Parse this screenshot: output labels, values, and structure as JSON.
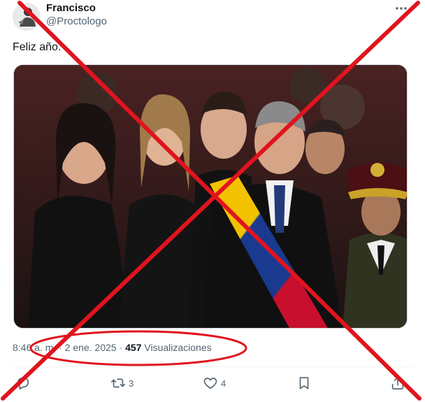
{
  "author": {
    "name": "Francisco",
    "handle": "@Proctologo"
  },
  "tweet": {
    "text": "Feliz año."
  },
  "meta": {
    "time": "8:46 a. m.",
    "sep1": " · ",
    "date": "2 ene. 2025",
    "sep2": " · ",
    "views": "457",
    "views_label": " Visualizaciones"
  },
  "actions": {
    "replies": "",
    "retweets": "3",
    "likes": "4"
  },
  "icons": {
    "more": "more-horizontal-icon",
    "reply": "reply-icon",
    "retweet": "retweet-icon",
    "like": "heart-icon",
    "bookmark": "bookmark-icon",
    "share": "share-icon"
  },
  "colors": {
    "annotation_red": "#e0141e",
    "muted": "#536471",
    "border": "#cfd9de"
  }
}
